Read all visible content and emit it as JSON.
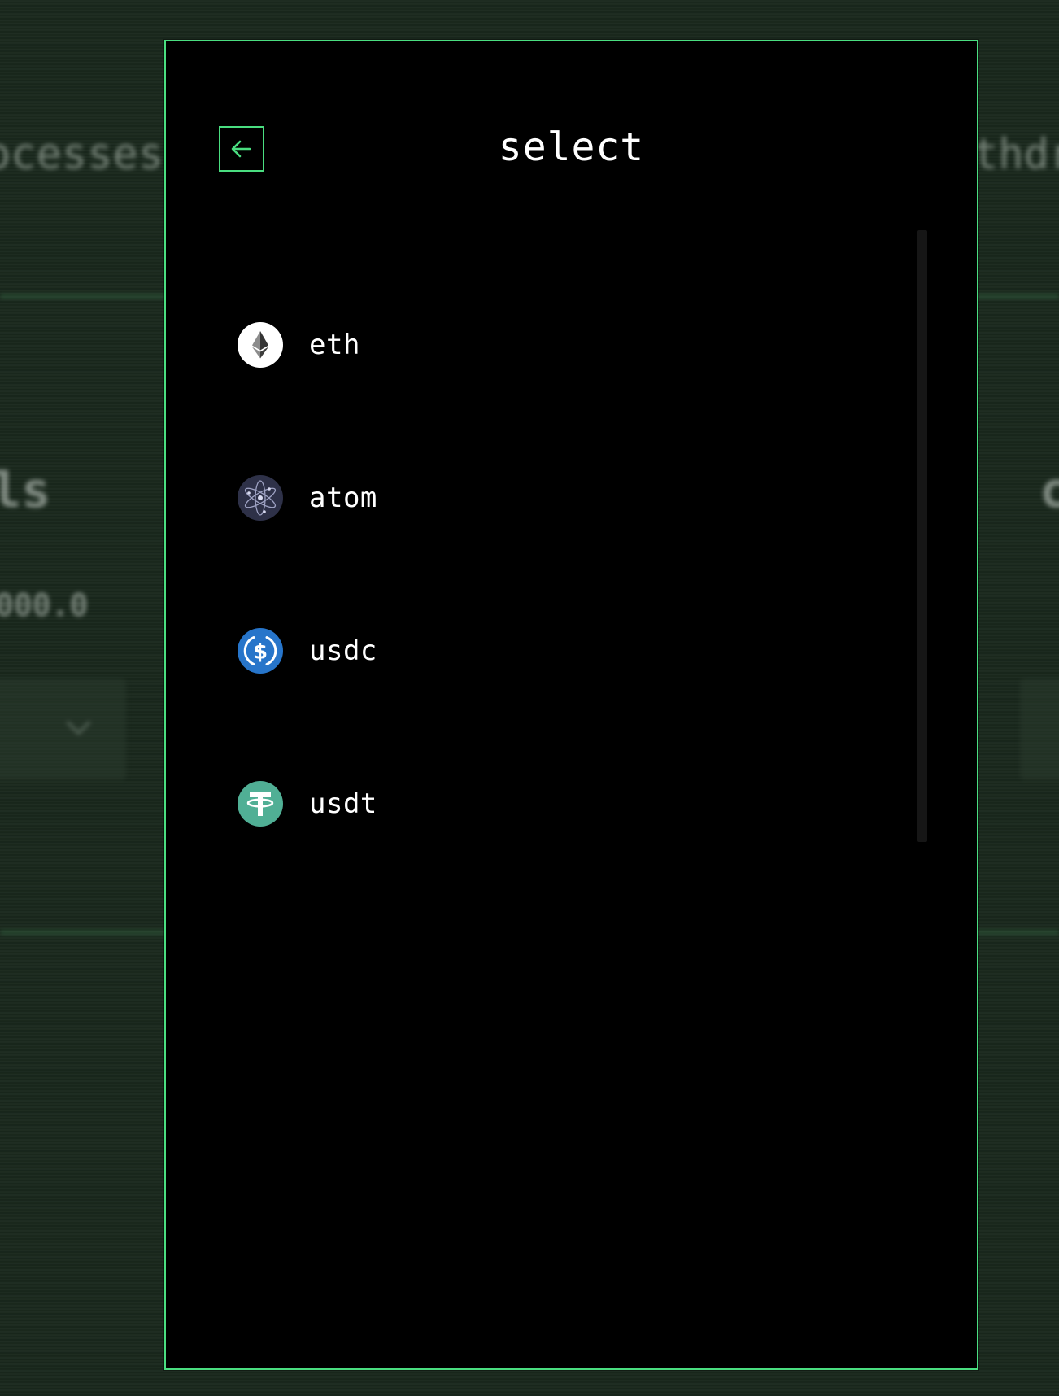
{
  "background": {
    "tab_left": "ocesses",
    "tab_right": "thdr",
    "heading_left": "ls",
    "heading_right": "c",
    "value_left": "000.0"
  },
  "modal": {
    "title": "select",
    "back_icon": "arrow-left-icon",
    "accent_color": "#4ade80"
  },
  "tokens": [
    {
      "label": "eth",
      "icon": "eth-icon",
      "color": "#ffffff"
    },
    {
      "label": "atom",
      "icon": "atom-icon",
      "color": "#2e3148"
    },
    {
      "label": "usdc",
      "icon": "usdc-icon",
      "color": "#2775ca"
    },
    {
      "label": "usdt",
      "icon": "usdt-icon",
      "color": "#50af95"
    }
  ]
}
